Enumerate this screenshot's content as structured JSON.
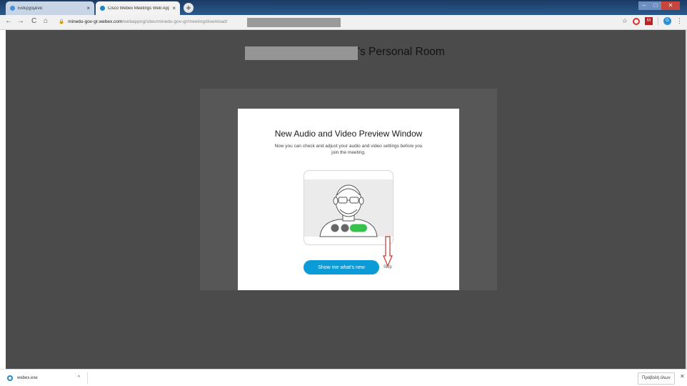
{
  "browser": {
    "tabs": [
      {
        "label": "Εισερχόμενα",
        "active": false,
        "icon": "mail-icon",
        "color": "#4a90d9"
      },
      {
        "label": "Cisco Webex Meetings Web App",
        "active": true,
        "icon": "webex-icon",
        "color": "#1f86c8"
      }
    ],
    "new_tab_symbol": "+",
    "close_symbol": "×",
    "window_controls": {
      "minimize": "–",
      "maximize": "□",
      "close": "✕"
    },
    "nav": {
      "back": "←",
      "forward": "→",
      "reload": "C",
      "home": "⌂"
    },
    "url": {
      "lock": "🔒",
      "host": "minedu-gov-gr.webex.com",
      "path": "/webappng/sites/minedu-gov-gr/meeting/download/"
    },
    "toolbar_icons": {
      "bookmark": "☆",
      "extension": "M",
      "profile": "G",
      "menu": "⋮"
    }
  },
  "page": {
    "room_title": "'s Personal Room",
    "background_color": "#4b4b4b"
  },
  "modal": {
    "title": "New Audio and Video Preview Window",
    "description": "Now you can check and adjust your audio and video settings before you join the meeting.",
    "primary_button": "Show me what's new",
    "skip_link": "Skip",
    "accent_color": "#0a9bd8"
  },
  "download_bar": {
    "file_name": "webex.exe",
    "chevron": "^",
    "show_all": "Προβολή όλων",
    "close": "✕"
  }
}
